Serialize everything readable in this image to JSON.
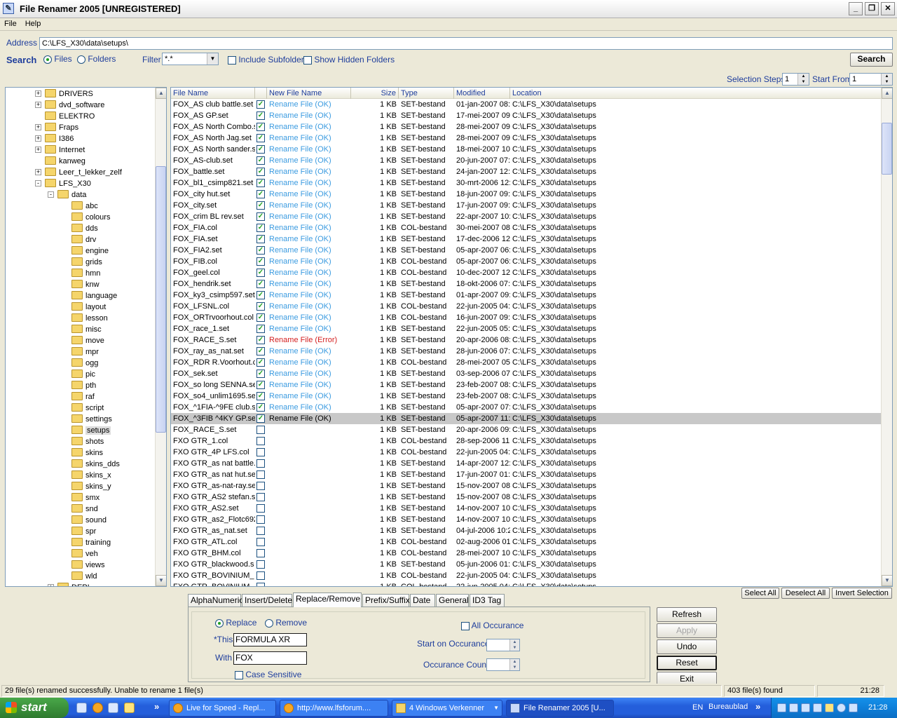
{
  "window": {
    "title": "File Renamer 2005 [UNREGISTERED]"
  },
  "menu": [
    "File",
    "Help"
  ],
  "address": {
    "label": "Address",
    "value": "C:\\LFS_X30\\data\\setups\\"
  },
  "search": {
    "label": "Search",
    "files": "Files",
    "folders": "Folders",
    "filter_label": "Filter",
    "filter_value": "*.*",
    "include_subfolder": "Include Subfolder",
    "show_hidden": "Show Hidden Folders",
    "button": "Search"
  },
  "selection": {
    "steps_label": "Selection Steps",
    "steps_value": "1",
    "start_label": "Start From",
    "start_value": "1"
  },
  "tree": [
    {
      "label": "DRIVERS",
      "level": 0,
      "exp": "+"
    },
    {
      "label": "dvd_software",
      "level": 0,
      "exp": "+"
    },
    {
      "label": "ELEKTRO",
      "level": 0,
      "exp": ""
    },
    {
      "label": "Fraps",
      "level": 0,
      "exp": "+"
    },
    {
      "label": "I386",
      "level": 0,
      "exp": "+"
    },
    {
      "label": "Internet",
      "level": 0,
      "exp": "+"
    },
    {
      "label": "kanweg",
      "level": 0,
      "exp": ""
    },
    {
      "label": "Leer_t_lekker_zelf",
      "level": 0,
      "exp": "+"
    },
    {
      "label": "LFS_X30",
      "level": 0,
      "exp": "-"
    },
    {
      "label": "data",
      "level": 1,
      "exp": "-"
    },
    {
      "label": "abc",
      "level": 2,
      "exp": ""
    },
    {
      "label": "colours",
      "level": 2,
      "exp": ""
    },
    {
      "label": "dds",
      "level": 2,
      "exp": ""
    },
    {
      "label": "drv",
      "level": 2,
      "exp": ""
    },
    {
      "label": "engine",
      "level": 2,
      "exp": ""
    },
    {
      "label": "grids",
      "level": 2,
      "exp": ""
    },
    {
      "label": "hmn",
      "level": 2,
      "exp": ""
    },
    {
      "label": "knw",
      "level": 2,
      "exp": ""
    },
    {
      "label": "language",
      "level": 2,
      "exp": ""
    },
    {
      "label": "layout",
      "level": 2,
      "exp": ""
    },
    {
      "label": "lesson",
      "level": 2,
      "exp": ""
    },
    {
      "label": "misc",
      "level": 2,
      "exp": ""
    },
    {
      "label": "move",
      "level": 2,
      "exp": ""
    },
    {
      "label": "mpr",
      "level": 2,
      "exp": ""
    },
    {
      "label": "ogg",
      "level": 2,
      "exp": ""
    },
    {
      "label": "pic",
      "level": 2,
      "exp": ""
    },
    {
      "label": "pth",
      "level": 2,
      "exp": ""
    },
    {
      "label": "raf",
      "level": 2,
      "exp": ""
    },
    {
      "label": "script",
      "level": 2,
      "exp": ""
    },
    {
      "label": "settings",
      "level": 2,
      "exp": ""
    },
    {
      "label": "setups",
      "level": 2,
      "exp": "",
      "selected": true
    },
    {
      "label": "shots",
      "level": 2,
      "exp": ""
    },
    {
      "label": "skins",
      "level": 2,
      "exp": ""
    },
    {
      "label": "skins_dds",
      "level": 2,
      "exp": ""
    },
    {
      "label": "skins_x",
      "level": 2,
      "exp": ""
    },
    {
      "label": "skins_y",
      "level": 2,
      "exp": ""
    },
    {
      "label": "smx",
      "level": 2,
      "exp": ""
    },
    {
      "label": "snd",
      "level": 2,
      "exp": ""
    },
    {
      "label": "sound",
      "level": 2,
      "exp": ""
    },
    {
      "label": "spr",
      "level": 2,
      "exp": ""
    },
    {
      "label": "training",
      "level": 2,
      "exp": ""
    },
    {
      "label": "veh",
      "level": 2,
      "exp": ""
    },
    {
      "label": "views",
      "level": 2,
      "exp": ""
    },
    {
      "label": "wld",
      "level": 2,
      "exp": ""
    },
    {
      "label": "DEPI",
      "level": 1,
      "exp": "+"
    }
  ],
  "columns": [
    "File Name",
    "",
    "New File Name",
    "Size",
    "Type",
    "Modified",
    "Location"
  ],
  "rows": [
    [
      "FOX_AS club battle.set",
      true,
      "Rename File (OK)",
      "1 KB",
      "SET-bestand",
      "01-jan-2007 08:",
      "C:\\LFS_X30\\data\\setups"
    ],
    [
      "FOX_AS GP.set",
      true,
      "Rename File (OK)",
      "1 KB",
      "SET-bestand",
      "17-mei-2007 09",
      "C:\\LFS_X30\\data\\setups"
    ],
    [
      "FOX_AS North Combo.s",
      true,
      "Rename File (OK)",
      "1 KB",
      "SET-bestand",
      "28-mei-2007 09",
      "C:\\LFS_X30\\data\\setups"
    ],
    [
      "FOX_AS North Jag.set",
      true,
      "Rename File (OK)",
      "1 KB",
      "SET-bestand",
      "28-mei-2007 09",
      "C:\\LFS_X30\\data\\setups"
    ],
    [
      "FOX_AS North sander.s",
      true,
      "Rename File (OK)",
      "1 KB",
      "SET-bestand",
      "18-mei-2007 10",
      "C:\\LFS_X30\\data\\setups"
    ],
    [
      "FOX_AS-club.set",
      true,
      "Rename File (OK)",
      "1 KB",
      "SET-bestand",
      "20-jun-2007 07:",
      "C:\\LFS_X30\\data\\setups"
    ],
    [
      "FOX_battle.set",
      true,
      "Rename File (OK)",
      "1 KB",
      "SET-bestand",
      "24-jan-2007 12:",
      "C:\\LFS_X30\\data\\setups"
    ],
    [
      "FOX_bl1_csimp821.set",
      true,
      "Rename File (OK)",
      "1 KB",
      "SET-bestand",
      "30-mrt-2006 12:",
      "C:\\LFS_X30\\data\\setups"
    ],
    [
      "FOX_city hut.set",
      true,
      "Rename File (OK)",
      "1 KB",
      "SET-bestand",
      "18-jun-2007 09:",
      "C:\\LFS_X30\\data\\setups"
    ],
    [
      "FOX_city.set",
      true,
      "Rename File (OK)",
      "1 KB",
      "SET-bestand",
      "17-jun-2007 09:",
      "C:\\LFS_X30\\data\\setups"
    ],
    [
      "FOX_crim BL rev.set",
      true,
      "Rename File (OK)",
      "1 KB",
      "SET-bestand",
      "22-apr-2007 10:",
      "C:\\LFS_X30\\data\\setups"
    ],
    [
      "FOX_FIA.col",
      true,
      "Rename File (OK)",
      "1 KB",
      "COL-bestand",
      "30-mei-2007 08",
      "C:\\LFS_X30\\data\\setups"
    ],
    [
      "FOX_FIA.set",
      true,
      "Rename File (OK)",
      "1 KB",
      "SET-bestand",
      "17-dec-2006 12",
      "C:\\LFS_X30\\data\\setups"
    ],
    [
      "FOX_FIA2.set",
      true,
      "Rename File (OK)",
      "1 KB",
      "SET-bestand",
      "05-apr-2007 06:",
      "C:\\LFS_X30\\data\\setups"
    ],
    [
      "FOX_FIB.col",
      true,
      "Rename File (OK)",
      "1 KB",
      "COL-bestand",
      "05-apr-2007 06:",
      "C:\\LFS_X30\\data\\setups"
    ],
    [
      "FOX_geel.col",
      true,
      "Rename File (OK)",
      "1 KB",
      "COL-bestand",
      "10-dec-2007 12",
      "C:\\LFS_X30\\data\\setups"
    ],
    [
      "FOX_hendrik.set",
      true,
      "Rename File (OK)",
      "1 KB",
      "SET-bestand",
      "18-okt-2006 07:",
      "C:\\LFS_X30\\data\\setups"
    ],
    [
      "FOX_ky3_csimp597.set",
      true,
      "Rename File (OK)",
      "1 KB",
      "SET-bestand",
      "01-apr-2007 09:",
      "C:\\LFS_X30\\data\\setups"
    ],
    [
      "FOX_LFSNL.col",
      true,
      "Rename File (OK)",
      "1 KB",
      "COL-bestand",
      "22-jun-2005 04:",
      "C:\\LFS_X30\\data\\setups"
    ],
    [
      "FOX_ORTrvoorhout.col",
      true,
      "Rename File (OK)",
      "1 KB",
      "COL-bestand",
      "16-jun-2007 09:",
      "C:\\LFS_X30\\data\\setups"
    ],
    [
      "FOX_race_1.set",
      true,
      "Rename File (OK)",
      "1 KB",
      "SET-bestand",
      "22-jun-2005 05:",
      "C:\\LFS_X30\\data\\setups"
    ],
    [
      "FOX_RACE_S.set",
      true,
      "Rename File (Error)",
      "1 KB",
      "SET-bestand",
      "20-apr-2006 08:",
      "C:\\LFS_X30\\data\\setups"
    ],
    [
      "FOX_ray_as_nat.set",
      true,
      "Rename File (OK)",
      "1 KB",
      "SET-bestand",
      "28-jun-2006 07:",
      "C:\\LFS_X30\\data\\setups"
    ],
    [
      "FOX_RDR R.Voorhout.c",
      true,
      "Rename File (OK)",
      "1 KB",
      "COL-bestand",
      "28-mei-2007 05",
      "C:\\LFS_X30\\data\\setups"
    ],
    [
      "FOX_sek.set",
      true,
      "Rename File (OK)",
      "1 KB",
      "SET-bestand",
      "03-sep-2006 07",
      "C:\\LFS_X30\\data\\setups"
    ],
    [
      "FOX_so long SENNA.se",
      true,
      "Rename File (OK)",
      "1 KB",
      "SET-bestand",
      "23-feb-2007 08:",
      "C:\\LFS_X30\\data\\setups"
    ],
    [
      "FOX_so4_unlim1695.set",
      true,
      "Rename File (OK)",
      "1 KB",
      "SET-bestand",
      "23-feb-2007 08:",
      "C:\\LFS_X30\\data\\setups"
    ],
    [
      "FOX_^1FIA-^9FE club.s",
      true,
      "Rename File (OK)",
      "1 KB",
      "SET-bestand",
      "05-apr-2007 07:",
      "C:\\LFS_X30\\data\\setups"
    ],
    [
      "FOX_^3FIB ^4KY GP.se",
      true,
      "Rename File (OK)",
      "1 KB",
      "SET-bestand",
      "05-apr-2007 11:",
      "C:\\LFS_X30\\data\\setups"
    ],
    [
      "FOX_RACE_S.set",
      false,
      "",
      "1 KB",
      "SET-bestand",
      "20-apr-2006 09:",
      "C:\\LFS_X30\\data\\setups"
    ],
    [
      "FXO GTR_1.col",
      false,
      "",
      "1 KB",
      "COL-bestand",
      "28-sep-2006 11",
      "C:\\LFS_X30\\data\\setups"
    ],
    [
      "FXO GTR_4P LFS.col",
      false,
      "",
      "1 KB",
      "COL-bestand",
      "22-jun-2005 04:",
      "C:\\LFS_X30\\data\\setups"
    ],
    [
      "FXO GTR_as nat battle.",
      false,
      "",
      "1 KB",
      "SET-bestand",
      "14-apr-2007 12:",
      "C:\\LFS_X30\\data\\setups"
    ],
    [
      "FXO GTR_as nat hut.se",
      false,
      "",
      "1 KB",
      "SET-bestand",
      "17-jun-2007 01:",
      "C:\\LFS_X30\\data\\setups"
    ],
    [
      "FXO GTR_as-nat-ray.se",
      false,
      "",
      "1 KB",
      "SET-bestand",
      "15-nov-2007 08",
      "C:\\LFS_X30\\data\\setups"
    ],
    [
      "FXO GTR_AS2 stefan.s",
      false,
      "",
      "1 KB",
      "SET-bestand",
      "15-nov-2007 08",
      "C:\\LFS_X30\\data\\setups"
    ],
    [
      "FXO GTR_AS2.set",
      false,
      "",
      "1 KB",
      "SET-bestand",
      "14-nov-2007 10",
      "C:\\LFS_X30\\data\\setups"
    ],
    [
      "FXO GTR_as2_Flotc692",
      false,
      "",
      "1 KB",
      "SET-bestand",
      "14-nov-2007 10",
      "C:\\LFS_X30\\data\\setups"
    ],
    [
      "FXO GTR_as_nat.set",
      false,
      "",
      "1 KB",
      "SET-bestand",
      "04-jul-2006 10:2",
      "C:\\LFS_X30\\data\\setups"
    ],
    [
      "FXO GTR_ATL.col",
      false,
      "",
      "1 KB",
      "COL-bestand",
      "02-aug-2006 01",
      "C:\\LFS_X30\\data\\setups"
    ],
    [
      "FXO GTR_BHM.col",
      false,
      "",
      "1 KB",
      "COL-bestand",
      "28-mei-2007 10",
      "C:\\LFS_X30\\data\\setups"
    ],
    [
      "FXO GTR_blackwood.s",
      false,
      "",
      "1 KB",
      "SET-bestand",
      "05-jun-2006 01:",
      "C:\\LFS_X30\\data\\setups"
    ],
    [
      "FXO GTR_BOVINIUM_",
      false,
      "",
      "1 KB",
      "COL-bestand",
      "22-jun-2005 04:",
      "C:\\LFS_X30\\data\\setups"
    ],
    [
      "FXO GTR_BOVINIUM_",
      false,
      "",
      "1 KB",
      "COL-bestand",
      "22-jun-2005 04:",
      "C:\\LFS_X30\\data\\setups"
    ]
  ],
  "selected_row": 28,
  "select_buttons": {
    "select_all": "Select All",
    "deselect_all": "Deselect All",
    "invert": "Invert Selection"
  },
  "tabs": [
    "AlphaNumeric",
    "Insert/Delete",
    "Replace/Remove",
    "Prefix/Suffix",
    "Date",
    "General",
    "ID3 Tag"
  ],
  "active_tab": 2,
  "replace": {
    "replace_label": "Replace",
    "remove_label": "Remove",
    "this_label": "*This",
    "this_value": "FORMULA XR",
    "with_label": "With",
    "with_value": "FOX",
    "case_sensitive": "Case Sensitive",
    "all_occurance": "All Occurance",
    "start_on_occurance": "Start on Occurance",
    "occurance_count": "Occurance Count"
  },
  "actions": {
    "refresh": "Refresh",
    "apply": "Apply",
    "undo": "Undo",
    "reset": "Reset",
    "exit": "Exit"
  },
  "status": {
    "message": "29 file(s) renamed successfully. Unable to rename 1 file(s)",
    "found": "403 file(s) found",
    "time": "21:28"
  },
  "taskbar": {
    "start": "start",
    "tasks": [
      "Live for Speed - Repl...",
      "http://www.lfsforum....",
      "4 Windows Verkenner",
      "File Renamer 2005 [U..."
    ],
    "lang": "EN",
    "desktop": "Bureaublad",
    "clock": "21:28"
  },
  "colors": {
    "ok": "#3b9be0",
    "error": "#d42020",
    "label_blue": "#1e3d9c",
    "selected_row": "#c8c8c8"
  }
}
